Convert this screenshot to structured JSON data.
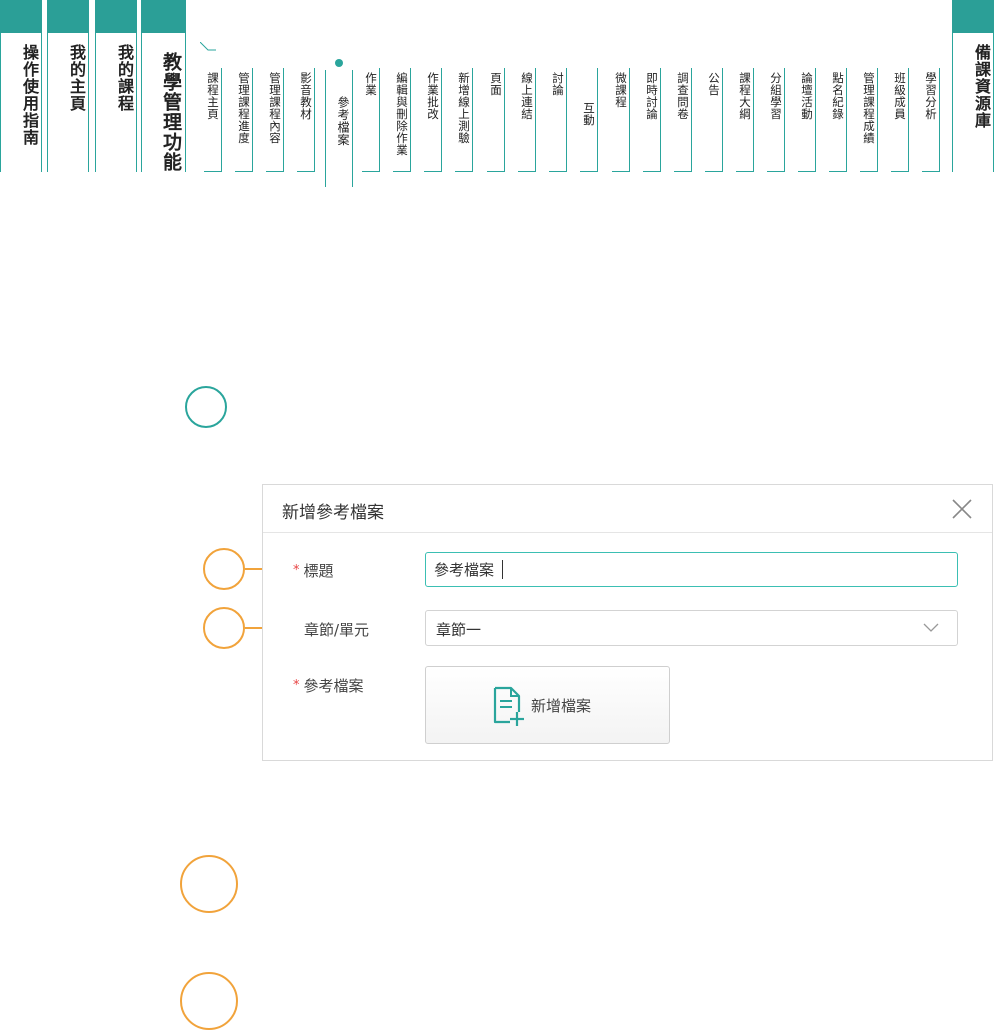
{
  "main_tabs": [
    {
      "label": "操作使用指南"
    },
    {
      "label": "我的主頁"
    },
    {
      "label": "我的課程"
    },
    {
      "label": "教學管理功能"
    }
  ],
  "right_tab": {
    "label": "備課資源庫"
  },
  "sub_tabs": [
    "課程主頁",
    "管理課程進度",
    "管理課程內容",
    "影音教材",
    "參考檔案",
    "作業",
    "編輯與刪除作業",
    "作業批改",
    "新增線上測驗",
    "頁面",
    "線上連結",
    "討論",
    "互動",
    "微課程",
    "即時討論",
    "調查問卷",
    "公告",
    "課程大綱",
    "分組學習",
    "論壇活動",
    "點名紀錄",
    "管理課程成績",
    "班級成員",
    "學習分析"
  ],
  "active_sub_tab": "參考檔案",
  "dialog": {
    "title": "新增參考檔案",
    "close_icon": "close-icon",
    "title_label": "標題",
    "title_value": "參考檔案",
    "chapter_label": "章節/單元",
    "chapter_value": "章節一",
    "file_label": "參考檔案",
    "add_file_button": "新增檔案",
    "required_mark": "*"
  },
  "colors": {
    "teal": "#2aa59c",
    "teal_cap": "#2b9f97",
    "orange": "#f1a33b",
    "required_red": "#e84343"
  }
}
